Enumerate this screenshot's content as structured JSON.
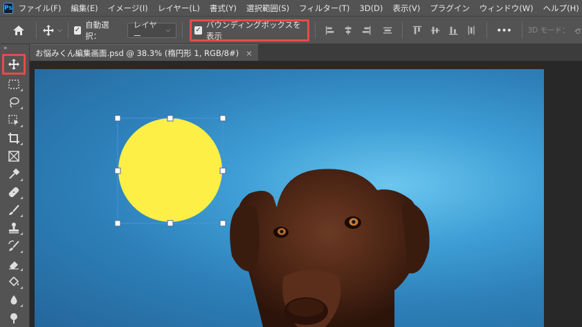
{
  "app": {
    "logo": "Ps"
  },
  "menubar": {
    "items": [
      "ファイル(F)",
      "編集(E)",
      "イメージ(I)",
      "レイヤー(L)",
      "書式(Y)",
      "選択範囲(S)",
      "フィルター(T)",
      "3D(D)",
      "表示(V)",
      "プラグイン",
      "ウィンドウ(W)",
      "ヘルプ(H)"
    ]
  },
  "options": {
    "auto_select_label": "自動選択：",
    "auto_select_target": "レイヤー",
    "bounding_box_label": "バウンディングボックスを表示",
    "more_label": "•••",
    "mode_3d_label": "3D モード："
  },
  "document": {
    "tab_title": "お悩みくん編集画面.psd @ 38.3% (楕円形 1, RGB/8#)",
    "close_symbol": "×"
  },
  "collapse_toggle": "»",
  "colors": {
    "accent_highlight": "#e84b4b",
    "shape_fill": "#fdef45",
    "selection": "#4a90e2"
  },
  "tools": [
    "move-tool",
    "marquee-tool",
    "lasso-tool",
    "object-selection-tool",
    "crop-tool",
    "frame-tool",
    "eyedropper-tool",
    "healing-brush-tool",
    "brush-tool",
    "clone-stamp-tool",
    "history-brush-tool",
    "eraser-tool",
    "paint-bucket-tool",
    "blur-tool",
    "dodge-tool"
  ]
}
